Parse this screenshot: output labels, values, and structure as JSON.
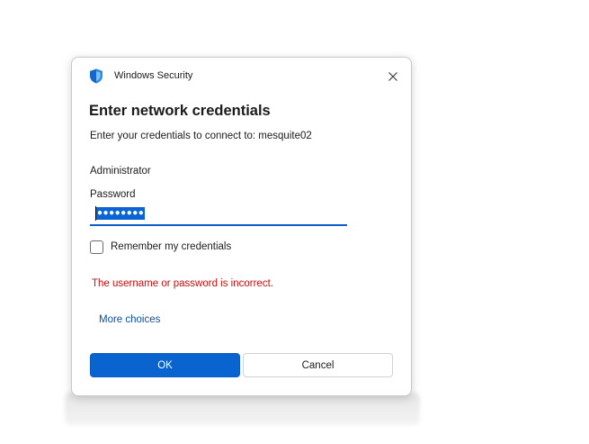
{
  "window": {
    "app_title": "Windows Security",
    "close_icon": "close-icon",
    "app_icon": "shield-icon"
  },
  "dialog": {
    "heading": "Enter network credentials",
    "subtext": "Enter your credentials to connect to: mesquite02",
    "username": "Administrator",
    "password_label": "Password",
    "password_value": "●●●●●●●●",
    "remember_label": "Remember my credentials",
    "remember_checked": false,
    "error_message": "The username or password is incorrect.",
    "more_choices": "More choices",
    "ok_label": "OK",
    "cancel_label": "Cancel"
  },
  "colors": {
    "accent": "#0a64d0",
    "error": "#c41010",
    "link": "#0a4e9b"
  }
}
